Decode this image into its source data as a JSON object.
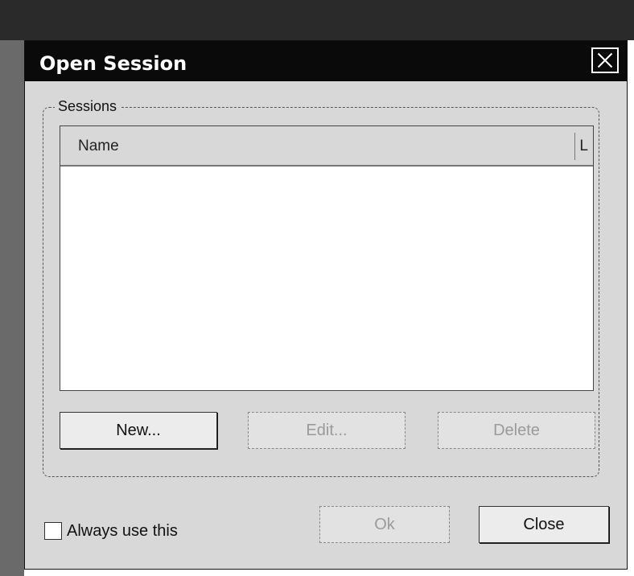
{
  "dialog": {
    "title": "Open Session",
    "close_icon": "close-icon"
  },
  "sessions": {
    "group_label": "Sessions",
    "columns": [
      "Name",
      "L"
    ],
    "rows": []
  },
  "buttons": {
    "new_label": "New...",
    "edit_label": "Edit...",
    "delete_label": "Delete",
    "ok_label": "Ok",
    "close_label": "Close"
  },
  "always_use": {
    "label": "Always use this",
    "checked": false
  }
}
